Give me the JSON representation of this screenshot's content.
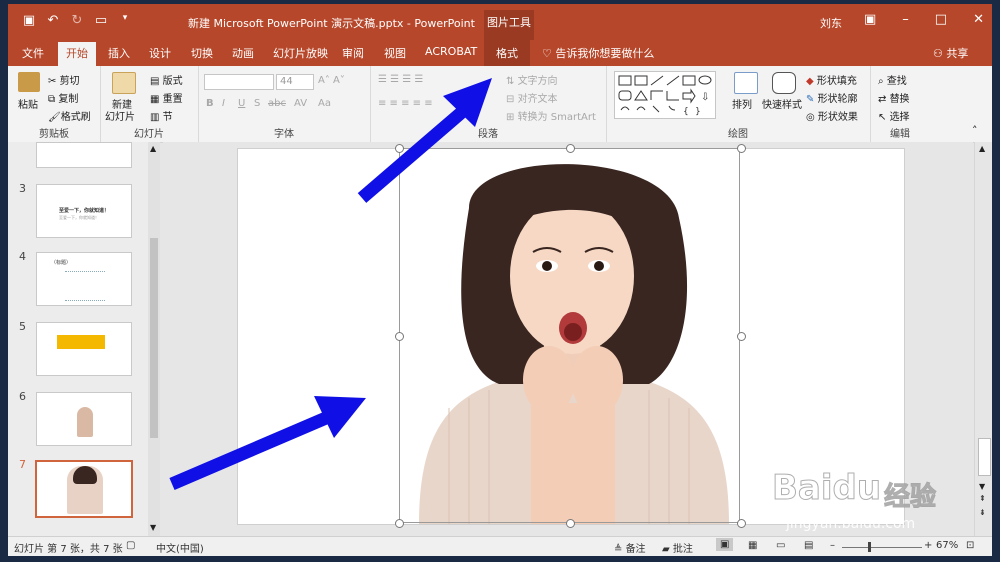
{
  "titlebar": {
    "qat_icons": [
      "save-icon",
      "undo-icon",
      "redo-icon",
      "slideshow-icon",
      "customize-icon"
    ],
    "title": "新建 Microsoft PowerPoint 演示文稿.pptx  -  PowerPoint",
    "tool_tab": "图片工具",
    "user": "刘东",
    "controls": [
      "minimize-icon",
      "restore-icon",
      "maximize-icon",
      "close-icon"
    ]
  },
  "tabs": [
    {
      "label": "文件"
    },
    {
      "label": "开始"
    },
    {
      "label": "插入"
    },
    {
      "label": "设计"
    },
    {
      "label": "切换"
    },
    {
      "label": "动画"
    },
    {
      "label": "幻灯片放映"
    },
    {
      "label": "审阅"
    },
    {
      "label": "视图"
    },
    {
      "label": "ACROBAT"
    },
    {
      "label": "格式"
    }
  ],
  "tellme": "告诉我你想要做什么",
  "share": "共享",
  "ribbon": {
    "clipboard": {
      "paste": "粘贴",
      "cut": "剪切",
      "copy": "复制",
      "format_painter": "格式刷",
      "label": "剪贴板"
    },
    "slides": {
      "new_slide": "新建",
      "new_slide2": "幻灯片",
      "layout": "版式",
      "reset": "重置",
      "section": "节",
      "label": "幻灯片"
    },
    "font": {
      "font_name": "",
      "font_size": "44",
      "bold": "B",
      "italic": "I",
      "underline": "U",
      "strike": "S",
      "shadow": "abc",
      "spacing": "AV",
      "case": "Aa",
      "label": "字体"
    },
    "paragraph": {
      "text_direction": "文字方向",
      "align_text": "对齐文本",
      "smartart": "转换为 SmartArt",
      "label": "段落"
    },
    "drawing": {
      "arrange": "排列",
      "quick_styles": "快速样式",
      "fill": "形状填充",
      "outline": "形状轮廓",
      "effects": "形状效果",
      "label": "绘图"
    },
    "editing": {
      "find": "查找",
      "replace": "替换",
      "select": "选择",
      "label": "编辑"
    }
  },
  "thumbnails": [
    {
      "num": "3",
      "text1": "至爱一下，你就知道！",
      "text2": "至爱一下，你就知道！"
    },
    {
      "num": "4",
      "text": "（标题）"
    },
    {
      "num": "5"
    },
    {
      "num": "6"
    },
    {
      "num": "7"
    }
  ],
  "status": {
    "slide_info": "幻灯片 第 7 张，共 7 张",
    "language": "中文(中国)",
    "notes": "备注",
    "comments": "批注",
    "zoom": "67%"
  },
  "watermark": {
    "brand": "Baidu",
    "brand_cn": "经验",
    "url": "jingyan.baidu.com"
  },
  "colors": {
    "accent": "#b7472a",
    "arrow": "#1010e6",
    "selected": "#d0643d"
  }
}
